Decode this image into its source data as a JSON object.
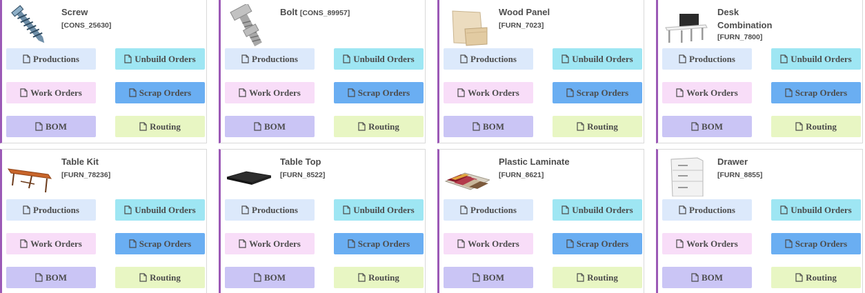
{
  "buttons": {
    "productions": "Productions",
    "unbuild_orders": "Unbuild Orders",
    "work_orders": "Work Orders",
    "scrap_orders": "Scrap Orders",
    "bom": "BOM",
    "routing": "Routing",
    "icon": "file-icon"
  },
  "colors": {
    "accent_border": "#9b59b6",
    "productions_bg": "#dce9fb",
    "unbuild_bg": "#9ee6f3",
    "work_orders_bg": "#f8ddf8",
    "scrap_bg": "#6aaef2",
    "bom_bg": "#cac5f5",
    "routing_bg": "#e8f6c3"
  },
  "products": [
    {
      "name": "Screw",
      "code": "[CONS_25630]",
      "image": "screw-image"
    },
    {
      "name": "Bolt",
      "code": "[CONS_89957]",
      "image": "bolt-image"
    },
    {
      "name": "Wood Panel",
      "code": "[FURN_7023]",
      "image": "wood-panel-image"
    },
    {
      "name": "Desk Combination",
      "code": "[FURN_7800]",
      "image": "desk-combination-image"
    },
    {
      "name": "Table Kit",
      "code": "[FURN_78236]",
      "image": "table-kit-image"
    },
    {
      "name": "Table Top",
      "code": "[FURN_8522]",
      "image": "table-top-image"
    },
    {
      "name": "Plastic Laminate",
      "code": "[FURN_8621]",
      "image": "plastic-laminate-image"
    },
    {
      "name": "Drawer",
      "code": "[FURN_8855]",
      "image": "drawer-image"
    }
  ]
}
